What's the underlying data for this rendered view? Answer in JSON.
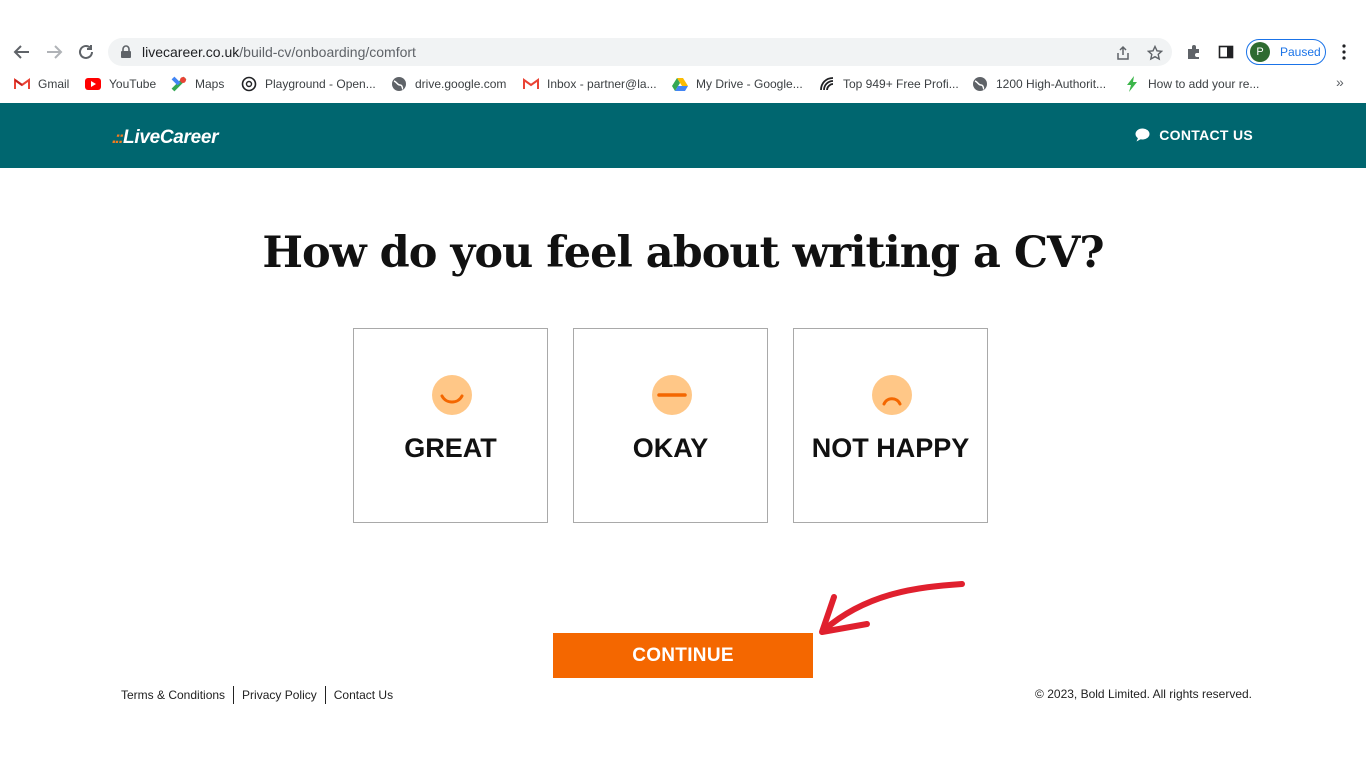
{
  "browser": {
    "url_domain": "livecareer.co.uk",
    "url_path": "/build-cv/onboarding/comfort",
    "profile_initial": "P",
    "profile_status": "Paused"
  },
  "bookmarks": [
    {
      "label": "Gmail",
      "icon": "gmail-icon"
    },
    {
      "label": "YouTube",
      "icon": "youtube-icon"
    },
    {
      "label": "Maps",
      "icon": "maps-icon"
    },
    {
      "label": "Playground - Open...",
      "icon": "openai-icon"
    },
    {
      "label": "drive.google.com",
      "icon": "globe-icon"
    },
    {
      "label": "Inbox - partner@la...",
      "icon": "gmail-icon"
    },
    {
      "label": "My Drive - Google...",
      "icon": "google-drive-icon"
    },
    {
      "label": "Top 949+ Free Profi...",
      "icon": "profile-icon"
    },
    {
      "label": "1200 High-Authorit...",
      "icon": "globe-icon"
    },
    {
      "label": "How to add your re...",
      "icon": "bolt-icon"
    }
  ],
  "bookmarks_more": "»",
  "site": {
    "logo": "LiveCareer",
    "contact_label": "CONTACT US"
  },
  "main": {
    "heading": "How do you feel about writing a CV?",
    "options": [
      {
        "label": "GREAT",
        "icon": "smile-face-icon"
      },
      {
        "label": "OKAY",
        "icon": "neutral-face-icon"
      },
      {
        "label": "NOT HAPPY",
        "icon": "sad-face-icon"
      }
    ],
    "continue_label": "CONTINUE"
  },
  "footer": {
    "terms": "Terms & Conditions",
    "privacy": "Privacy Policy",
    "contact": "Contact Us",
    "copyright": "© 2023, Bold Limited. All rights reserved."
  },
  "colors": {
    "header_bg": "#00666f",
    "accent_orange": "#f46700",
    "face_fill": "#ffc787",
    "face_stroke": "#f46700",
    "annotation_arrow": "#e0202e"
  }
}
